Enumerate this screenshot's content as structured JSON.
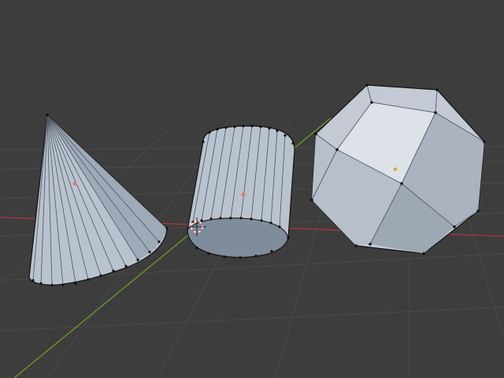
{
  "viewport": {
    "background": "#3d3d3d",
    "grid_color": "#4a4a4a",
    "x_axis_color": "#b0333f",
    "y_axis_color": "#6e9c2a"
  },
  "objects": [
    {
      "name": "cone",
      "type": "mesh",
      "face_color": "#b9c3cf",
      "origin_color": "#e0785a"
    },
    {
      "name": "cylinder",
      "type": "mesh",
      "face_color": "#b9c3cf",
      "origin_color": "#e0785a"
    },
    {
      "name": "icosphere",
      "type": "mesh",
      "face_color": "#c3cad4",
      "origin_color": "#f0a040"
    }
  ],
  "cursor_3d": {
    "icon": "3d-cursor-icon",
    "colors": [
      "#e0585a",
      "#ffffff"
    ]
  }
}
